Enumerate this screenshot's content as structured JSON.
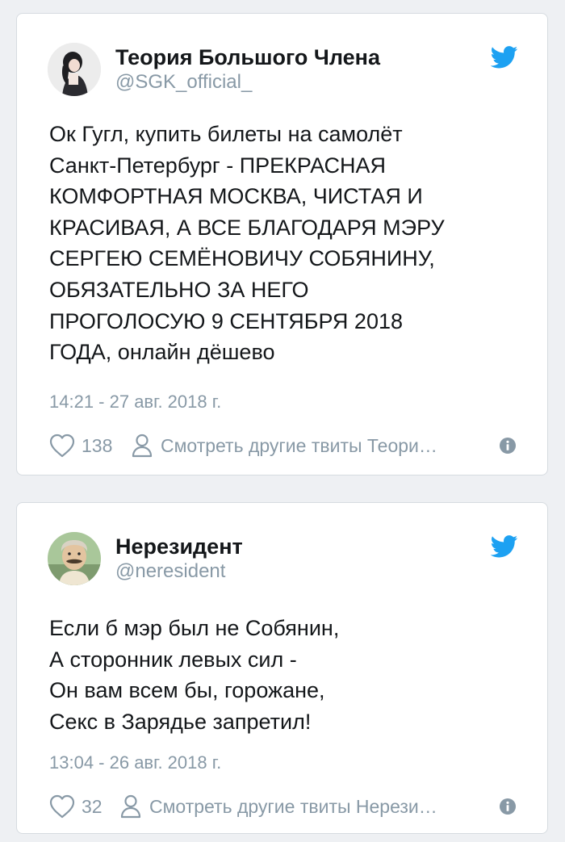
{
  "colors": {
    "background": "#eef0f3",
    "card": "#ffffff",
    "text": "#14171a",
    "muted": "#8899a6",
    "twitter_blue": "#1da1f2"
  },
  "tweets": [
    {
      "display_name": "Теория Большого Члена",
      "handle": "@SGK_official_",
      "text": "Ок Гугл, купить билеты на самолёт\nСанкт-Петербург - ПРЕКРАСНАЯ\nКОМФОРТНАЯ МОСКВА, ЧИСТАЯ И\nКРАСИВАЯ, А ВСЕ БЛАГОДАРЯ МЭРУ\nСЕРГЕЮ СЕМЁНОВИЧУ СОБЯНИНУ,\nОБЯЗАТЕЛЬНО ЗА НЕГО\nПРОГОЛОСУЮ 9 СЕНТЯБРЯ 2018\nГОДА,  онлайн дёшево",
      "timestamp": "14:21 - 27 авг. 2018 г.",
      "likes": "138",
      "more_label": "Смотреть другие твиты Теори…",
      "icons": [
        "avatar",
        "twitter-bird-icon",
        "heart-icon",
        "person-icon",
        "info-icon"
      ]
    },
    {
      "display_name": "Нерезидент",
      "handle": "@neresident",
      "text": "Если б мэр был не Собянин,\nА сторонник левых сил -\nОн вам всем бы, горожане,\nСекс в Зарядье запретил!",
      "timestamp": "13:04 - 26 авг. 2018 г.",
      "likes": "32",
      "more_label": "Смотреть другие твиты Нерези…",
      "icons": [
        "avatar",
        "twitter-bird-icon",
        "heart-icon",
        "person-icon",
        "info-icon"
      ]
    }
  ]
}
